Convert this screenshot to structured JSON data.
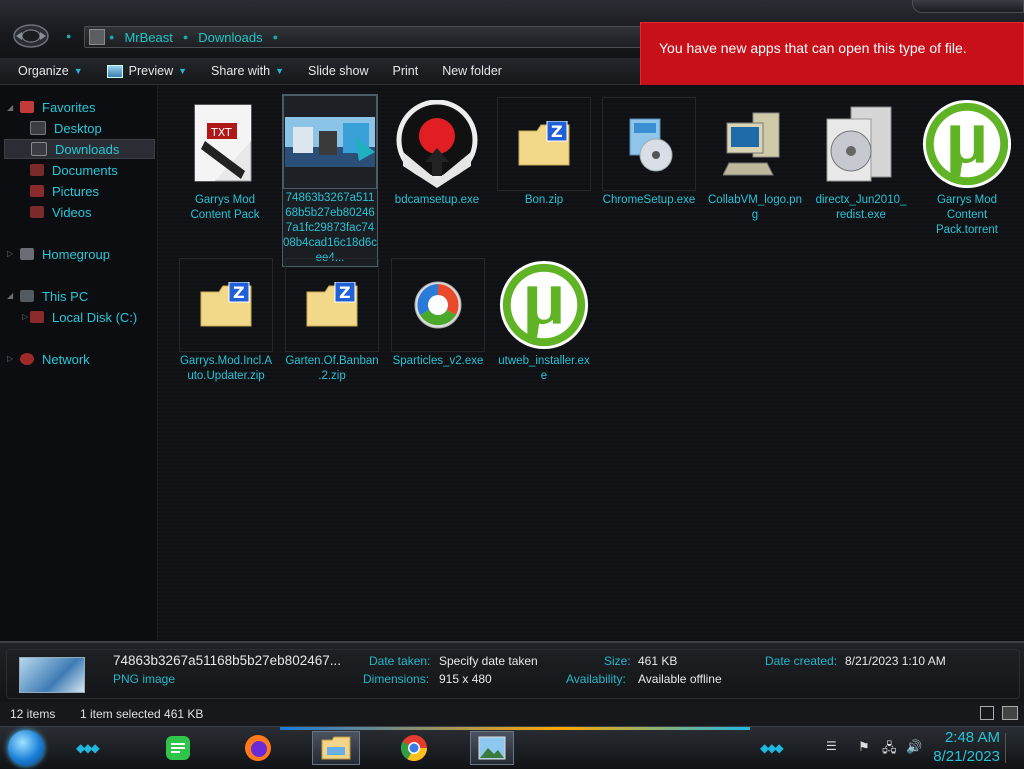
{
  "address": {
    "segments": [
      "MrBeast",
      "Downloads"
    ]
  },
  "toolbar": {
    "organize": "Organize",
    "preview": "Preview",
    "share_with": "Share with",
    "slide_show": "Slide show",
    "print": "Print",
    "new_folder": "New folder"
  },
  "notification": {
    "text": "You have new apps that can open this type of file."
  },
  "nav": {
    "favorites": "Favorites",
    "desktop": "Desktop",
    "downloads": "Downloads",
    "documents": "Documents",
    "pictures": "Pictures",
    "videos": "Videos",
    "homegroup": "Homegroup",
    "this_pc": "This PC",
    "local_disk": "Local Disk (C:)",
    "network": "Network"
  },
  "files": [
    {
      "name": "Garrys Mod Content Pack",
      "icon": "txt-game-icon"
    },
    {
      "name": "74863b3267a51168b5b27eb802467a1fc29873fac7408b4cad16c18d6cee4...",
      "icon": "image-thumbnail"
    },
    {
      "name": "bdcamsetup.exe",
      "icon": "record-installer-icon"
    },
    {
      "name": "Bon.zip",
      "icon": "zip-folder-icon"
    },
    {
      "name": "ChromeSetup.exe",
      "icon": "setup-cd-icon"
    },
    {
      "name": "CollabVM_logo.png",
      "icon": "computer-icon"
    },
    {
      "name": "directx_Jun2010_redist.exe",
      "icon": "installer-box-icon"
    },
    {
      "name": "Garrys Mod Content Pack.torrent",
      "icon": "utorrent-icon"
    },
    {
      "name": "Garrys.Mod.Incl.Auto.Updater.zip",
      "icon": "zip-folder-icon"
    },
    {
      "name": "Garten.Of.Banban.2.zip",
      "icon": "zip-folder-icon"
    },
    {
      "name": "Sparticles_v2.exe",
      "icon": "sparticles-icon"
    },
    {
      "name": "utweb_installer.exe",
      "icon": "utorrent-icon"
    }
  ],
  "details": {
    "filename": "74863b3267a51168b5b27eb802467...",
    "type": "PNG image",
    "date_taken_label": "Date taken:",
    "date_taken_value": "Specify date taken",
    "dimensions_label": "Dimensions:",
    "dimensions_value": "915 x 480",
    "size_label": "Size:",
    "size_value": "461 KB",
    "availability_label": "Availability:",
    "availability_value": "Available offline",
    "date_created_label": "Date created:",
    "date_created_value": "8/21/2023 1:10 AM"
  },
  "status": {
    "items": "12 items",
    "selected": "1 item selected  461 KB"
  },
  "clock": {
    "time": "2:48 AM",
    "date": "8/21/2023"
  },
  "colors": {
    "accent": "#27c3d6",
    "notification": "#c8101a"
  }
}
